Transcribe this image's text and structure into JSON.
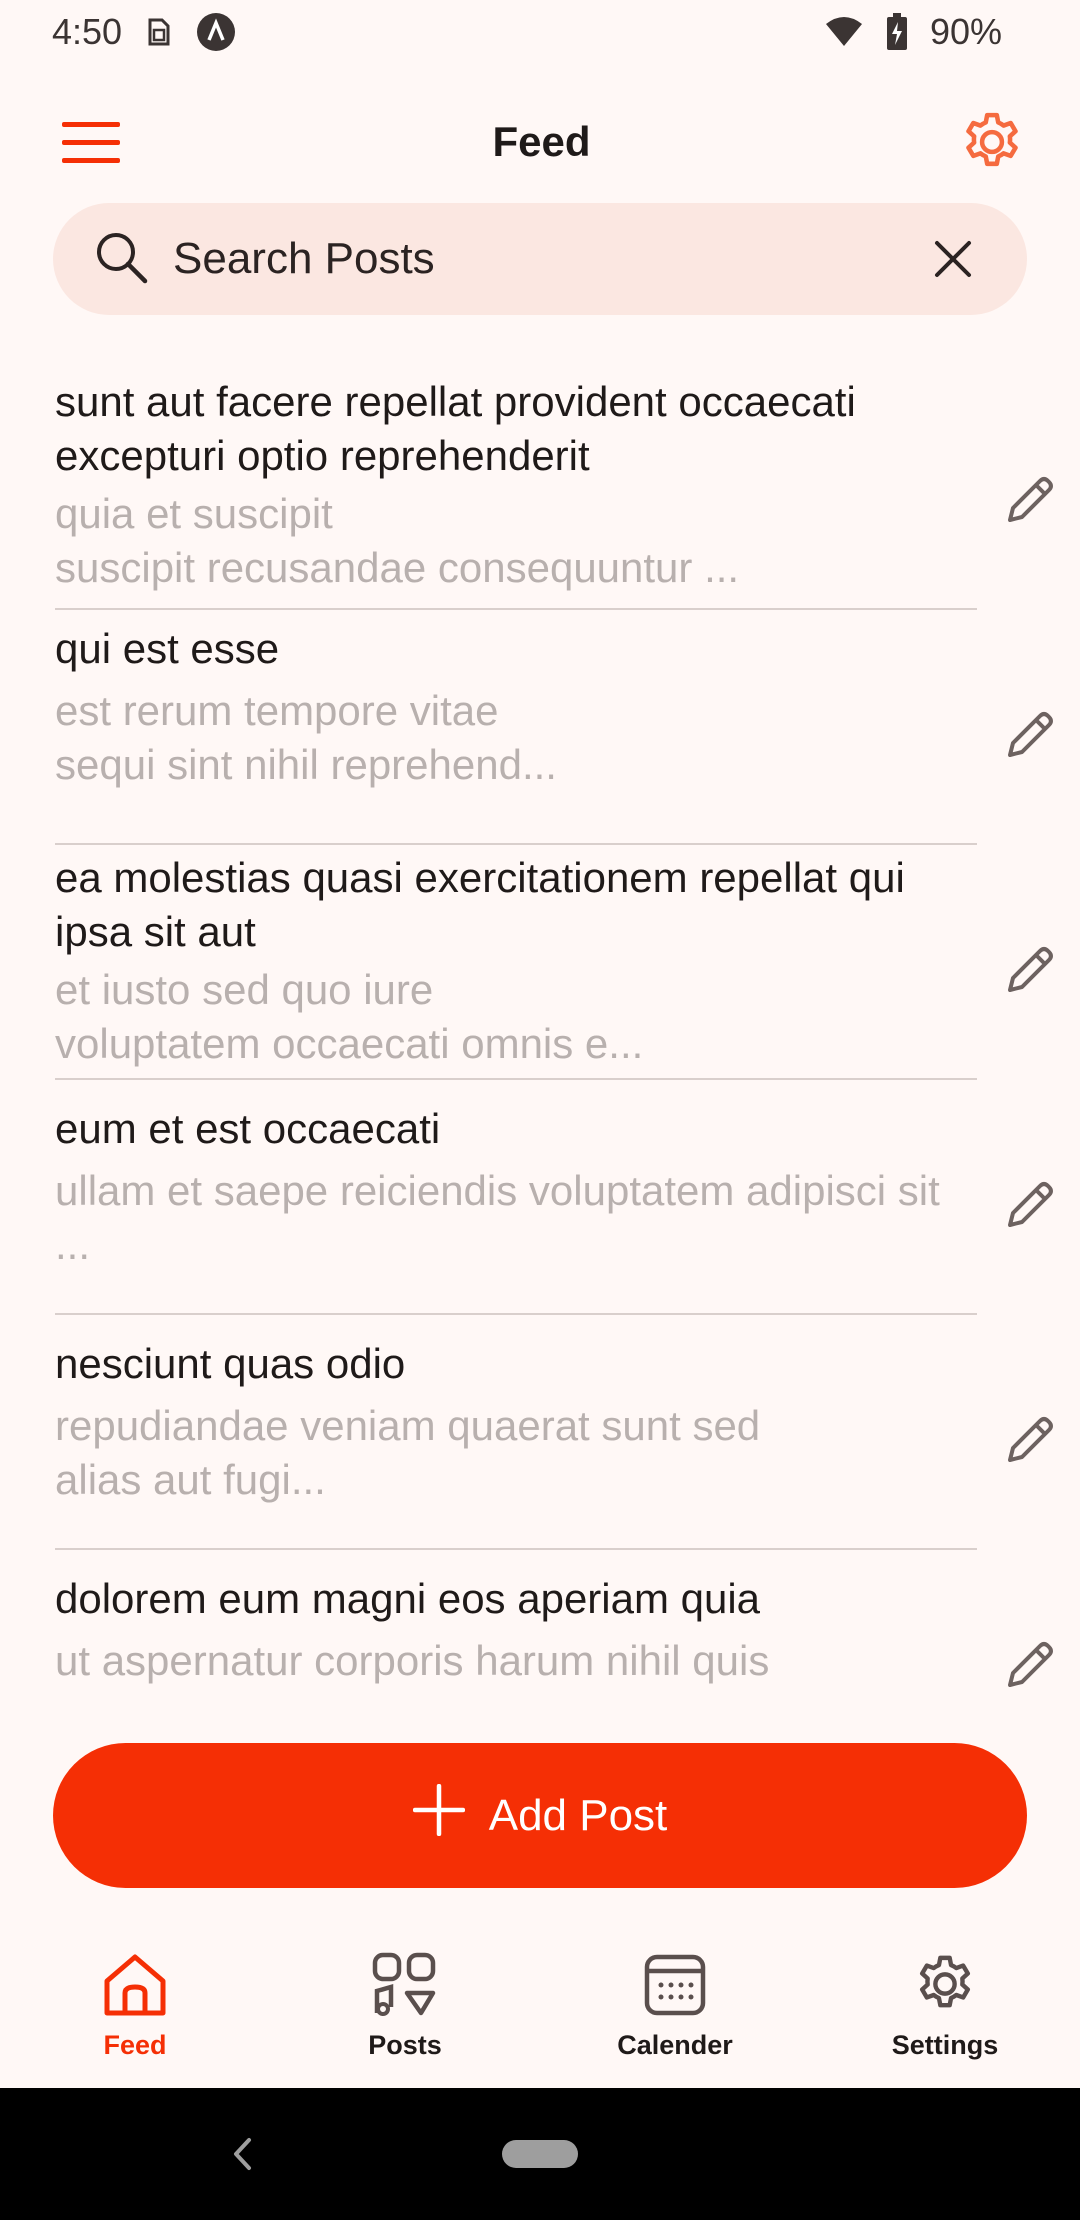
{
  "status_bar": {
    "time": "4:50",
    "battery": "90%",
    "icons": [
      "sim-icon",
      "a-circle-icon",
      "wifi-icon",
      "battery-charging-icon"
    ]
  },
  "app_bar": {
    "title": "Feed",
    "menu_icon": "hamburger-menu-icon",
    "settings_icon": "gear-icon"
  },
  "search": {
    "placeholder": "Search Posts",
    "value": ""
  },
  "posts": [
    {
      "title": "sunt aut facere repellat provident occaecati excepturi optio reprehenderit",
      "body": "quia et suscipit\nsuscipit recusandae consequuntur ..."
    },
    {
      "title": "qui est esse",
      "body": "est rerum tempore vitae\nsequi sint nihil reprehend..."
    },
    {
      "title": "ea molestias quasi exercitationem repellat qui ipsa sit aut",
      "body": "et iusto sed quo iure\nvoluptatem occaecati omnis e..."
    },
    {
      "title": "eum et est occaecati",
      "body": "ullam et saepe reiciendis voluptatem adipisci sit ..."
    },
    {
      "title": "nesciunt quas odio",
      "body": "repudiandae veniam quaerat sunt sed\nalias aut fugi..."
    },
    {
      "title": "dolorem eum magni eos aperiam quia",
      "body": "ut aspernatur corporis harum nihil quis"
    }
  ],
  "add_post": {
    "label": "Add Post"
  },
  "bottom_nav": {
    "items": [
      {
        "label": "Feed",
        "icon": "home-icon",
        "active": true
      },
      {
        "label": "Posts",
        "icon": "posts-icon",
        "active": false
      },
      {
        "label": "Calender",
        "icon": "calendar-icon",
        "active": false
      },
      {
        "label": "Settings",
        "icon": "gear-icon",
        "active": false
      }
    ]
  },
  "colors": {
    "accent": "#f52f05",
    "background": "#fff8f6",
    "search_bg": "#fbe7e1",
    "muted_text": "#b8b0ae"
  }
}
